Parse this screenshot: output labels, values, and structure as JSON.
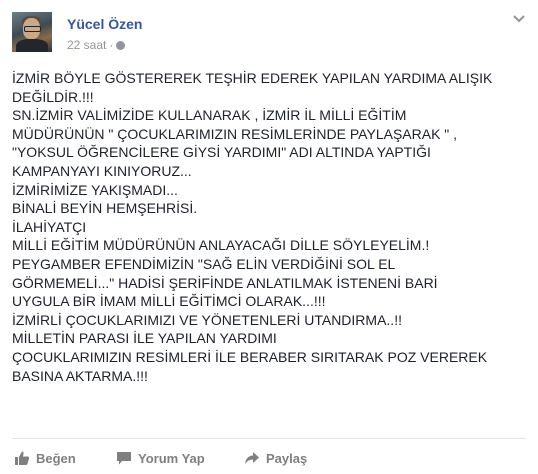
{
  "post": {
    "author": "Yücel Özen",
    "timestamp": "22 saat",
    "separator": "·",
    "privacy_icon": "globe-icon",
    "body_lines": [
      "İZMİR BÖYLE GÖSTEREREK TEŞHİR EDEREK YAPILAN YARDIMA ALIŞIK",
      "DEĞİLDİR.!!!",
      "SN.İZMİR VALİMİZİDE KULLANARAK , İZMİR İL MİLLİ EĞİTİM",
      "MÜDÜRÜNÜN \" ÇOCUKLARIMIZIN RESİMLERİNDE PAYLAŞARAK \" ,",
      "\"YOKSUL ÖĞRENCİLERE GİYSİ YARDIMI\" ADI ALTINDA YAPTIĞI",
      "KAMPANYAYI KINIYORUZ...",
      "İZMİRİMİZE YAKIŞMADI...",
      "BİNALİ BEYİN HEMŞEHRİSİ.",
      "İLAHİYATÇI",
      "MİLLİ EĞİTİM MÜDÜRÜNÜN ANLAYACAĞI DİLLE SÖYLEYELİM.!",
      "PEYGAMBER EFENDİMİZİN \"SAĞ ELİN VERDİĞİNİ SOL EL",
      "GÖRMEMELİ...\" HADİSİ ŞERİFİNDE ANLATILMAK İSTENENİ BARİ",
      "UYGULA BİR İMAM MİLLİ EĞİTİMCİ OLARAK...!!!",
      "İZMİRLİ ÇOCUKLARIMIZI VE YÖNETENLERİ UTANDIRMA..!!",
      "MİLLETİN PARASI İLE YAPILAN YARDIMI",
      "ÇOCUKLARIMIZIN RESİMLERİ İLE BERABER SIRITARAK POZ VEREREK",
      "BASINA AKTARMA.!!!"
    ]
  },
  "actions": {
    "like_label": "Beğen",
    "comment_label": "Yorum Yap",
    "share_label": "Paylaş"
  },
  "colors": {
    "author_link": "#365899",
    "meta_gray": "#90949c",
    "action_gray": "#7f7f7f",
    "text": "#1d2129"
  }
}
